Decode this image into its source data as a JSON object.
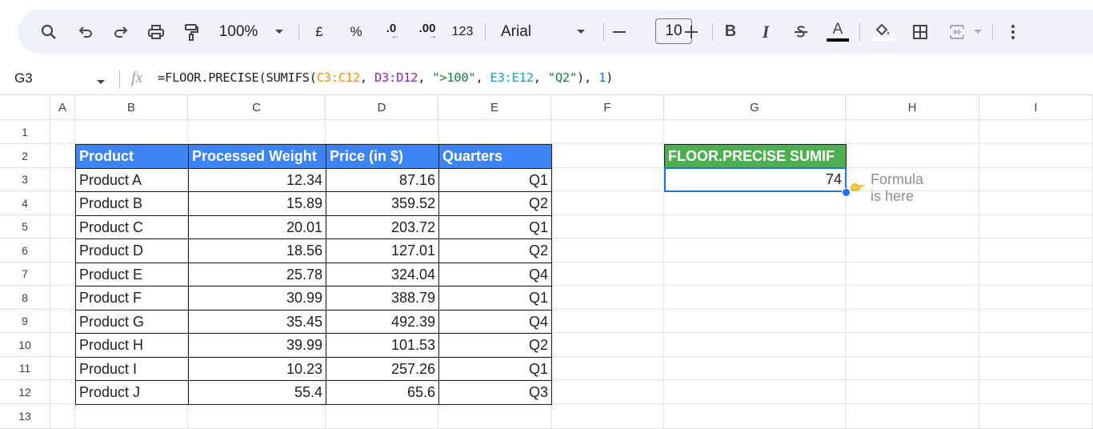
{
  "toolbar": {
    "zoom": "100%",
    "currency": "£",
    "percent": "%",
    "decrease_decimal": ".0",
    "increase_decimal": ".00",
    "number_format": "123",
    "font": "Arial",
    "font_size": "10",
    "icons": [
      "search-icon",
      "undo-icon",
      "redo-icon",
      "print-icon",
      "paint-format-icon",
      "dropdown-icon",
      "minus-icon",
      "plus-icon",
      "bold-icon",
      "italic-icon",
      "strikethrough-icon",
      "text-color-icon",
      "fill-color-icon",
      "borders-icon",
      "merge-cells-icon",
      "more-icon"
    ]
  },
  "formula_bar": {
    "cell_ref": "G3",
    "fx": "fx",
    "formula_parts": {
      "p1": "=FLOOR.PRECISE(SUMIFS(",
      "p2": "C3:C12",
      "p3": ", ",
      "p4": "D3:D12",
      "p5": ", ",
      "p6": "\">100\"",
      "p7": ", ",
      "p8": "E3:E12",
      "p9": ", ",
      "p10": "\"Q2\"",
      "p11": "), ",
      "p12": "1",
      "p13": ")"
    }
  },
  "columns": [
    "A",
    "B",
    "C",
    "D",
    "E",
    "F",
    "G",
    "H",
    "I"
  ],
  "rows": [
    "1",
    "2",
    "3",
    "4",
    "5",
    "6",
    "7",
    "8",
    "9",
    "10",
    "11",
    "12",
    "13"
  ],
  "table": {
    "headers": [
      "Product",
      "Processed Weight",
      "Price (in $)",
      "Quarters"
    ],
    "rows": [
      [
        "Product A",
        "12.34",
        "87.16",
        "Q1"
      ],
      [
        "Product B",
        "15.89",
        "359.52",
        "Q2"
      ],
      [
        "Product C",
        "20.01",
        "203.72",
        "Q1"
      ],
      [
        "Product D",
        "18.56",
        "127.01",
        "Q2"
      ],
      [
        "Product E",
        "25.78",
        "324.04",
        "Q4"
      ],
      [
        "Product F",
        "30.99",
        "388.79",
        "Q1"
      ],
      [
        "Product G",
        "35.45",
        "492.39",
        "Q4"
      ],
      [
        "Product H",
        "39.99",
        "101.53",
        "Q2"
      ],
      [
        "Product I",
        "10.23",
        "257.26",
        "Q1"
      ],
      [
        "Product J",
        "55.4",
        "65.6",
        "Q3"
      ]
    ]
  },
  "result": {
    "header": "FLOOR.PRECISE SUMIF",
    "value": "74",
    "note": "Formula is here",
    "note_icon": "pointing-hand-icon"
  },
  "colors": {
    "table_header": "#3d85f7",
    "result_header": "#4caf50",
    "selection": "#1a73e8"
  }
}
